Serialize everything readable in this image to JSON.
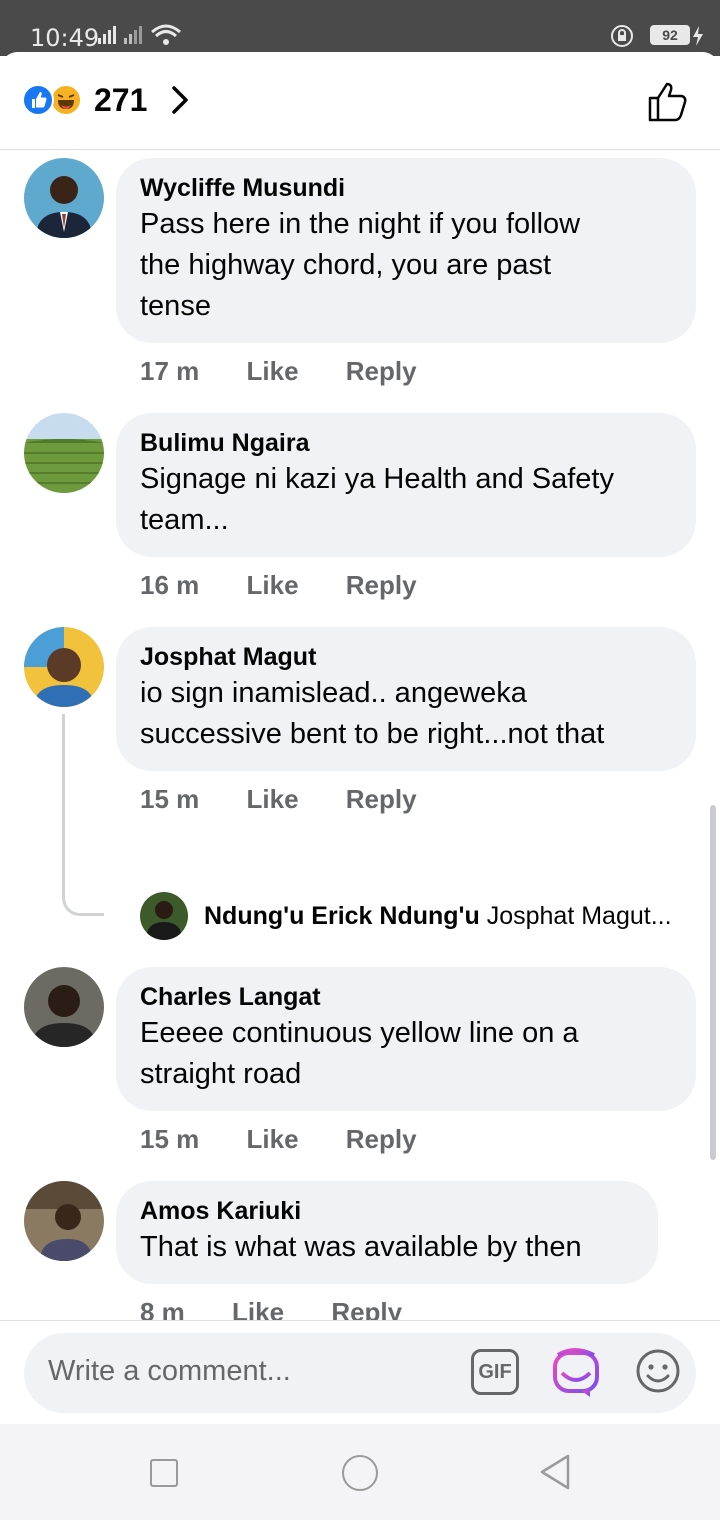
{
  "status_bar": {
    "time": "10:49",
    "battery": "92"
  },
  "reactions": {
    "count": "271",
    "types": [
      "like-icon",
      "haha-icon"
    ]
  },
  "comments": [
    {
      "author": "Wycliffe Musundi",
      "text": "Pass here in the night if you follow the highway chord, you are past tense",
      "lines": [
        "Pass here in the night if you follow",
        "the highway chord, you are past",
        "tense"
      ],
      "time": "17 m",
      "like": "Like",
      "reply": "Reply"
    },
    {
      "author": "Bulimu Ngaira",
      "lines": [
        "Signage ni kazi ya Health and Safety",
        "team..."
      ],
      "time": "16 m",
      "like": "Like",
      "reply": "Reply"
    },
    {
      "author": "Josphat Magut",
      "lines": [
        "io sign inamislead.. angeweka",
        "successive bent to be right...not that"
      ],
      "time": "15 m",
      "like": "Like",
      "reply": "Reply",
      "reply_preview": {
        "author": "Ndung'u Erick Ndung'u",
        "text": "Josphat Magut..."
      }
    },
    {
      "author": "Charles Langat",
      "lines": [
        "Eeeee continuous yellow line on a",
        "straight road"
      ],
      "time": "15 m",
      "like": "Like",
      "reply": "Reply"
    },
    {
      "author": "Amos Kariuki",
      "lines": [
        "That is what was available by then"
      ],
      "time": "8 m",
      "like": "Like",
      "reply": "Reply"
    }
  ],
  "composer": {
    "placeholder": "Write a comment...",
    "gif_label": "GIF"
  },
  "colors": {
    "accent": "#1877f2",
    "bubble": "#f0f2f5",
    "meta": "#65676b"
  }
}
